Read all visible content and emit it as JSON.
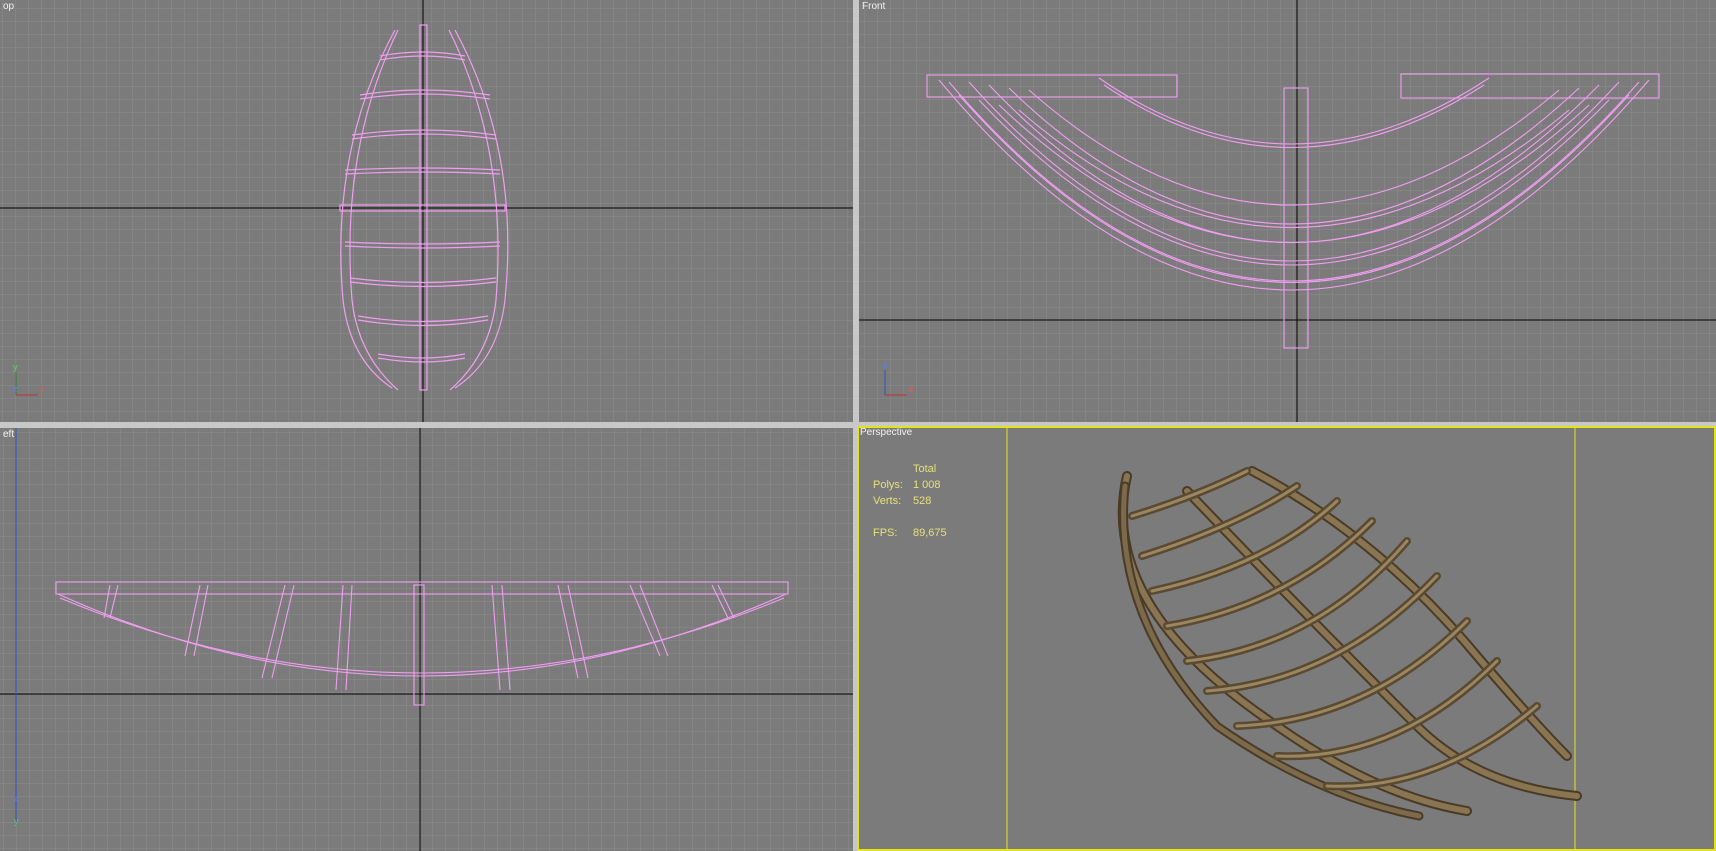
{
  "viewports": {
    "top": {
      "label": "op"
    },
    "front": {
      "label": "Front"
    },
    "left": {
      "label": "eft"
    },
    "perspective": {
      "label": "Perspective"
    }
  },
  "stats": {
    "header": "Total",
    "polys_label": "Polys:",
    "polys_value": "1 008",
    "verts_label": "Verts:",
    "verts_value": "528",
    "fps_label": "FPS:",
    "fps_value": "89,675"
  },
  "colors": {
    "viewport_bg": "#7b7b7b",
    "grid_minor": "#8c8c8c",
    "grid_major": "#9c9c9c",
    "world_axis": "#000000",
    "wireframe": "#f09ef0",
    "active_border": "#e3e31a",
    "stats_text": "#e8e07a",
    "wood": "#6b5a40"
  },
  "icons": {
    "axis_gizmo": "xyz-axis-tripod-icon"
  }
}
